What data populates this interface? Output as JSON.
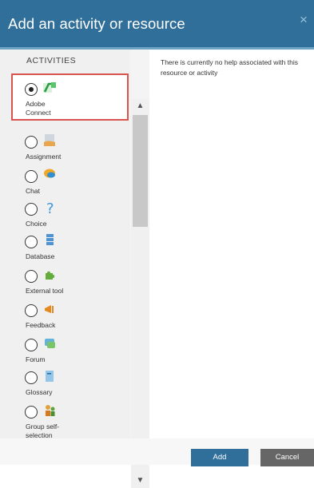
{
  "dialog": {
    "title": "Add an activity or resource",
    "close_glyph": "×"
  },
  "left_panel": {
    "header": "ACTIVITIES",
    "items": [
      {
        "label": "Adobe\nConnect",
        "icon": "adobe-connect-icon",
        "selected": true
      },
      {
        "label": "Assignment",
        "icon": "assignment-icon",
        "selected": false
      },
      {
        "label": "Chat",
        "icon": "chat-icon",
        "selected": false
      },
      {
        "label": "Choice",
        "icon": "choice-icon",
        "selected": false
      },
      {
        "label": "Database",
        "icon": "database-icon",
        "selected": false
      },
      {
        "label": "External tool",
        "icon": "external-tool-icon",
        "selected": false
      },
      {
        "label": "Feedback",
        "icon": "feedback-icon",
        "selected": false
      },
      {
        "label": "Forum",
        "icon": "forum-icon",
        "selected": false
      },
      {
        "label": "Glossary",
        "icon": "glossary-icon",
        "selected": false
      },
      {
        "label": "Group self-\nselection",
        "icon": "group-self-selection-icon",
        "selected": false
      }
    ]
  },
  "help": {
    "text": "There is currently no help associated with this resource or activity"
  },
  "footer": {
    "add_label": "Add",
    "cancel_label": "Cancel"
  },
  "colors": {
    "header_bg": "#2f6f99",
    "selection_border": "#d9534f",
    "cancel_bg": "#666666"
  }
}
